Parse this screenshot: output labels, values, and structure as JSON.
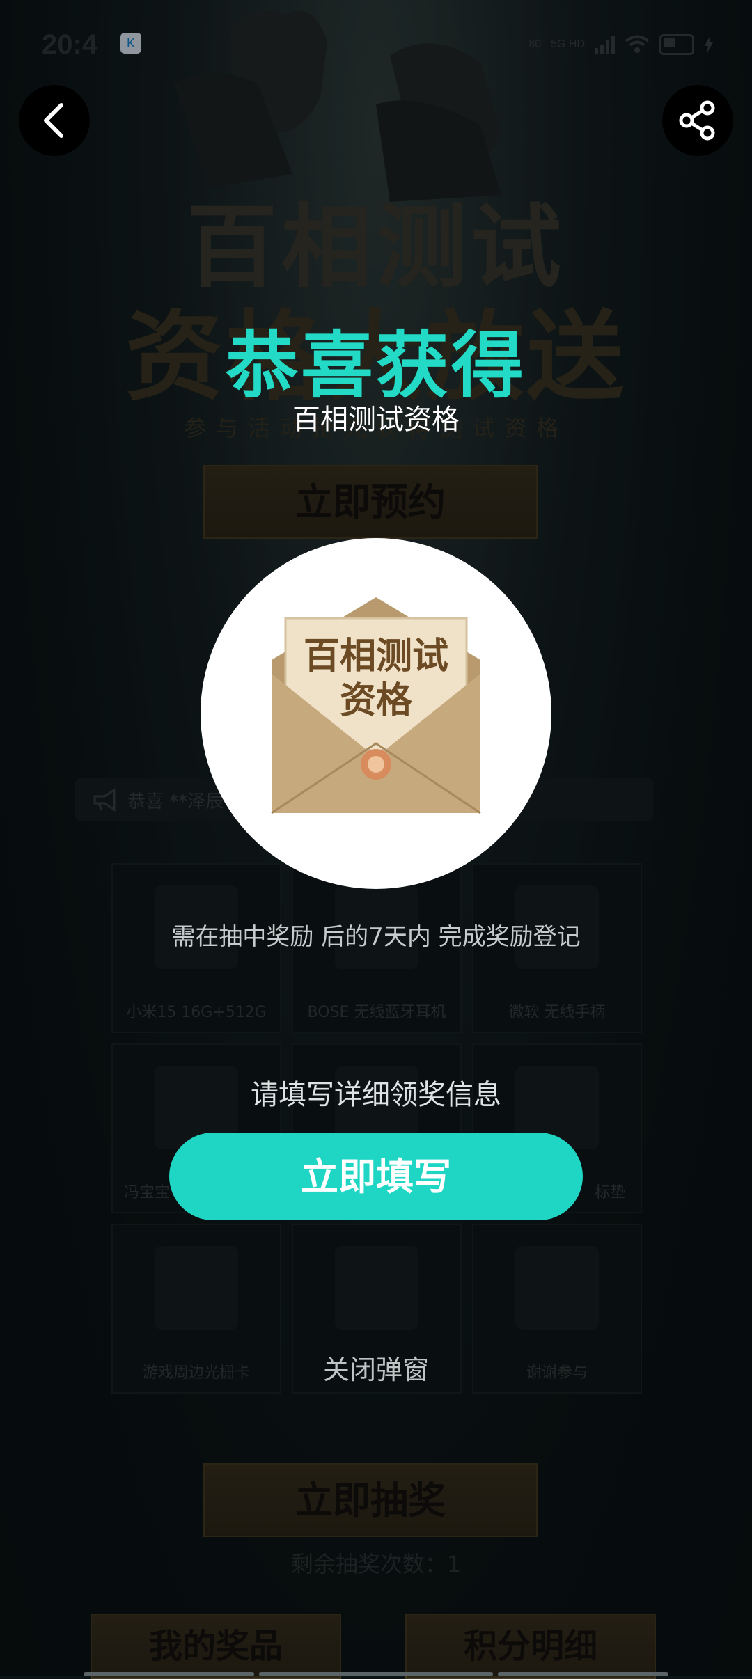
{
  "status_bar": {
    "time": "20:4",
    "network": "5G HD",
    "signal_text": "80"
  },
  "background": {
    "title_line1": "百相测试",
    "title_line2": "资格大放送",
    "subtitle": "参与活动抢先获得测试资格",
    "reserve_button": "立即预约",
    "ticker": "恭喜 **泽辰",
    "prizes": [
      {
        "label": "小米15 16G+512G"
      },
      {
        "label": "BOSE 无线蓝牙耳机"
      },
      {
        "label": "微软 无线手柄"
      },
      {
        "label": "冯宝宝"
      },
      {
        "label": ""
      },
      {
        "label": "标垫"
      },
      {
        "label": "游戏周边光栅卡"
      },
      {
        "label": ""
      },
      {
        "label": "谢谢参与"
      }
    ],
    "draw_button": "立即抽奖",
    "remaining_draws": "剩余抽奖次数：1",
    "my_prizes_button": "我的奖品",
    "points_button": "积分明细"
  },
  "popup": {
    "title": "恭喜获得",
    "prize_name": "百相测试资格",
    "envelope_text_line1": "百相测试",
    "envelope_text_line2": "资格",
    "note": "需在抽中奖励 后的7天内 完成奖励登记",
    "fill_prompt": "请填写详细领奖信息",
    "fill_button": "立即填写",
    "close_button": "关闭弹窗"
  },
  "colors": {
    "accent": "#1fd6c4",
    "title_accent": "#22dac5",
    "background": "#0b1518",
    "envelope": "#c4a47a"
  }
}
